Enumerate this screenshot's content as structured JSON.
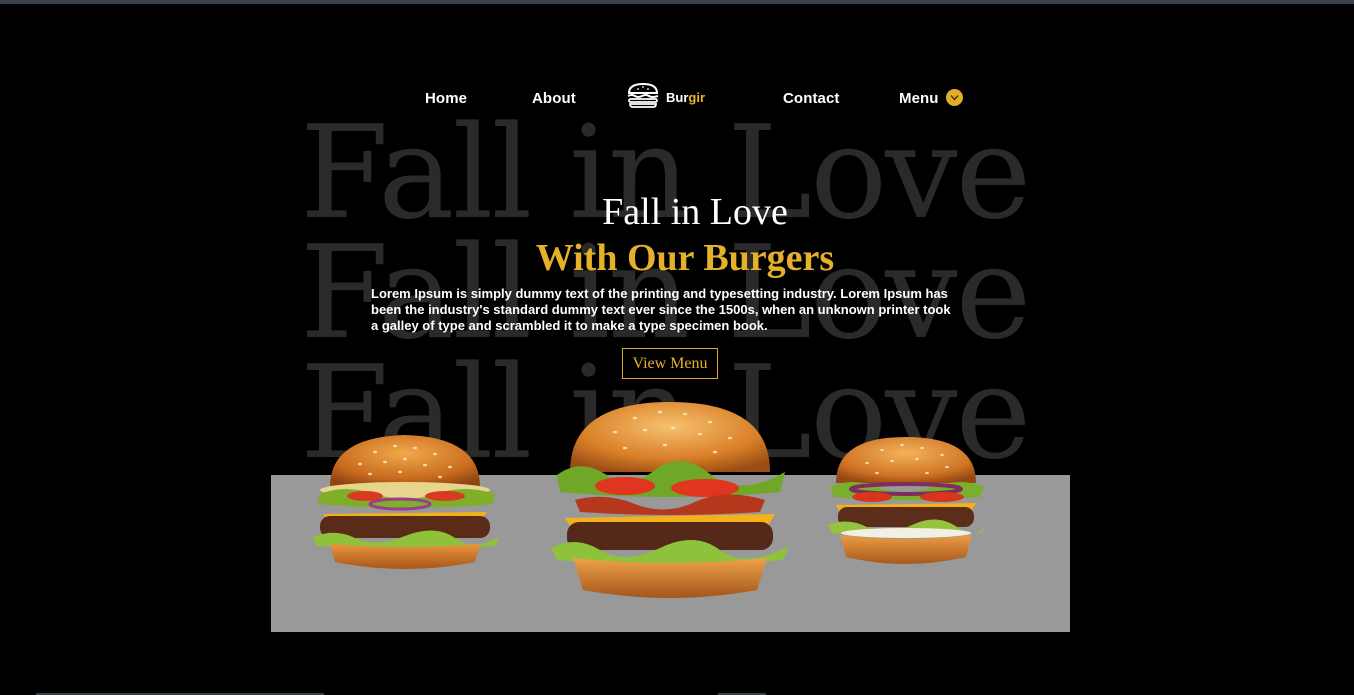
{
  "nav": {
    "home": "Home",
    "about": "About",
    "contact": "Contact",
    "menu": "Menu",
    "menu_icon": "chevron-down-icon"
  },
  "logo": {
    "icon": "burger-icon",
    "text_primary": "Bur",
    "text_accent": "gir"
  },
  "background_words": [
    "Fall in Love",
    "Fall in Love",
    "Fall in Love"
  ],
  "hero": {
    "title": "Fall in Love",
    "subtitle": "With Our Burgers",
    "description": "Lorem Ipsum is simply dummy text of the printing and typesetting industry. Lorem Ipsum has been the industry's standard dummy text ever since the 1500s, when an unknown printer took a galley of type and scrambled it to make a type specimen book.",
    "cta_label": "View Menu"
  },
  "colors": {
    "background": "#000000",
    "accent": "#e6b12a",
    "panel": "#999999",
    "watermark": "#2a2a2a"
  },
  "images": {
    "left": "burger-image-left",
    "center": "burger-image-center",
    "right": "burger-image-right"
  }
}
